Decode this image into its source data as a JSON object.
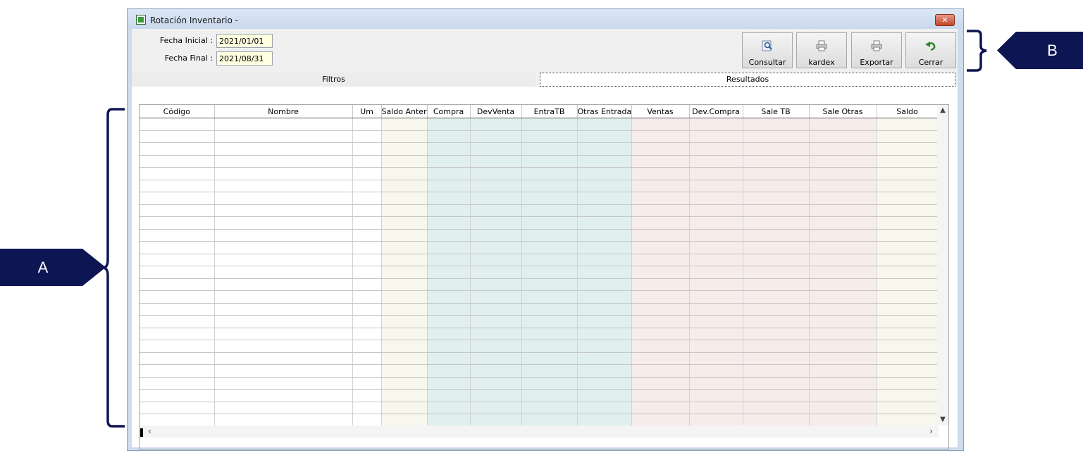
{
  "window": {
    "title": "Rotación Inventario -",
    "close_glyph": "✕"
  },
  "filters": {
    "fecha_inicial_label": "Fecha Inicial :",
    "fecha_inicial_value": "2021/01/01",
    "fecha_final_label": "Fecha Final :",
    "fecha_final_value": "2021/08/31"
  },
  "toolbar": {
    "consultar": "Consultar",
    "kardex": "kardex",
    "exportar": "Exportar",
    "cerrar": "Cerrar"
  },
  "tabs": {
    "filtros": "Filtros",
    "resultados": "Resultados"
  },
  "grid": {
    "columns": [
      {
        "label": "Código",
        "tint": "white"
      },
      {
        "label": "Nombre",
        "tint": "white"
      },
      {
        "label": "Um",
        "tint": "white"
      },
      {
        "label": "Saldo Anteri",
        "tint": "yellow"
      },
      {
        "label": "Compra",
        "tint": "cyan"
      },
      {
        "label": "DevVenta",
        "tint": "cyan"
      },
      {
        "label": "EntraTB",
        "tint": "cyan"
      },
      {
        "label": "Otras Entrada",
        "tint": "cyan"
      },
      {
        "label": "Ventas",
        "tint": "pink"
      },
      {
        "label": "Dev.Compra",
        "tint": "pink"
      },
      {
        "label": "Sale TB",
        "tint": "pink"
      },
      {
        "label": "Sale Otras",
        "tint": "pink"
      },
      {
        "label": "Saldo",
        "tint": "yellow"
      }
    ],
    "empty_rows": 25
  },
  "annotations": {
    "a": "A",
    "b": "B"
  },
  "colors": {
    "callout": "#0d1652",
    "column_yellow": "#f7f7ee",
    "column_cyan": "#e1f0ef",
    "column_pink": "#f6ecea",
    "input_bg": "#ffffe1"
  }
}
